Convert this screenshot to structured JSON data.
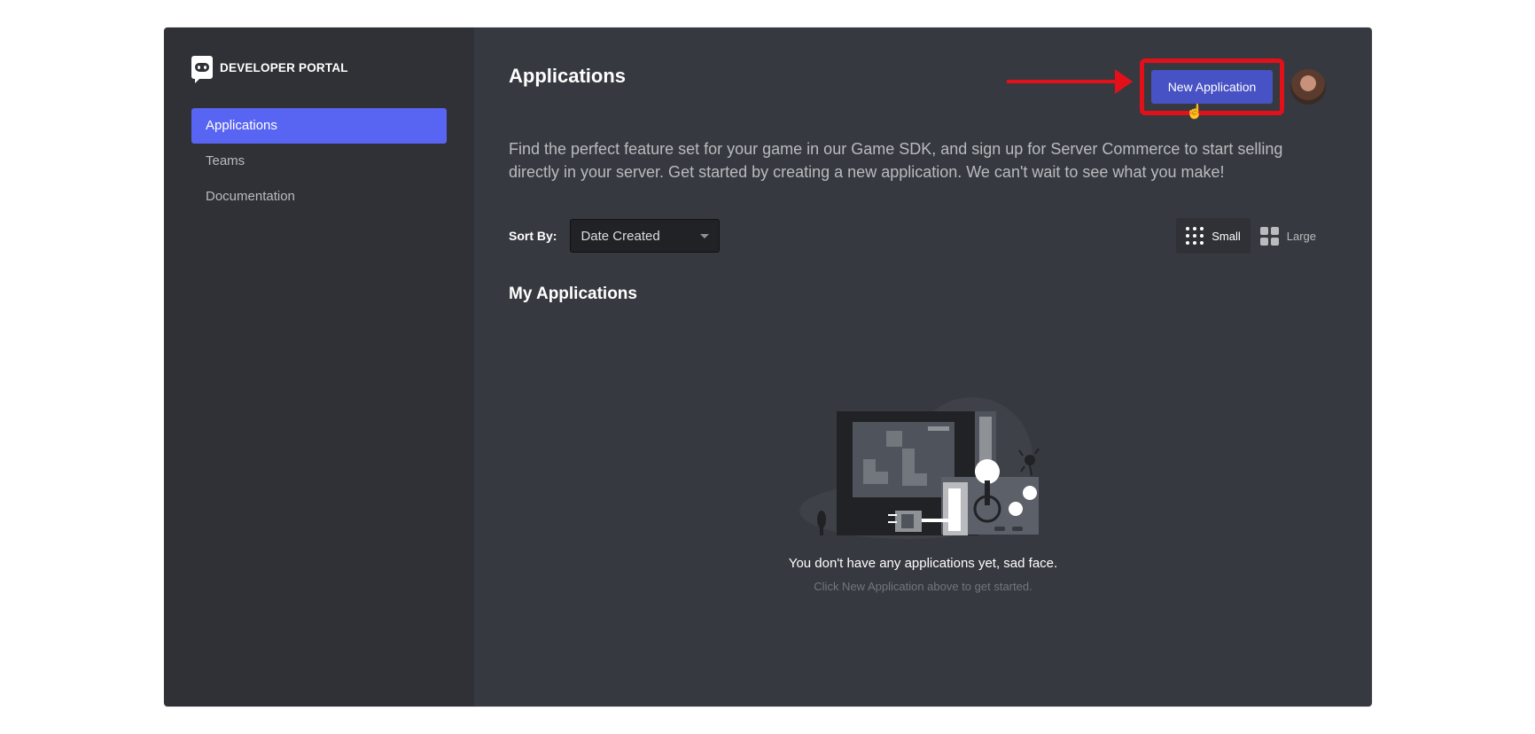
{
  "sidebar": {
    "brand": "DEVELOPER PORTAL",
    "items": [
      {
        "label": "Applications"
      },
      {
        "label": "Teams"
      },
      {
        "label": "Documentation"
      }
    ]
  },
  "header": {
    "title": "Applications",
    "new_app_label": "New Application",
    "description": "Find the perfect feature set for your game in our Game SDK, and sign up for Server Commerce to start selling directly in your server. Get started by creating a new application. We can't wait to see what you make!"
  },
  "sort": {
    "label": "Sort By:",
    "selected": "Date Created"
  },
  "view": {
    "small": "Small",
    "large": "Large"
  },
  "my_apps": {
    "title": "My Applications",
    "empty_title": "You don't have any applications yet, sad face.",
    "empty_sub": "Click New Application above to get started."
  },
  "colors": {
    "accent": "#5865f2",
    "button": "#4752c4",
    "highlight": "#e3101a"
  },
  "icons": {
    "logo": "discord-logo-icon",
    "cursor": "hand-pointer-icon",
    "small_grid": "grid-small-icon",
    "large_grid": "grid-large-icon",
    "caret": "chevron-down-icon"
  }
}
